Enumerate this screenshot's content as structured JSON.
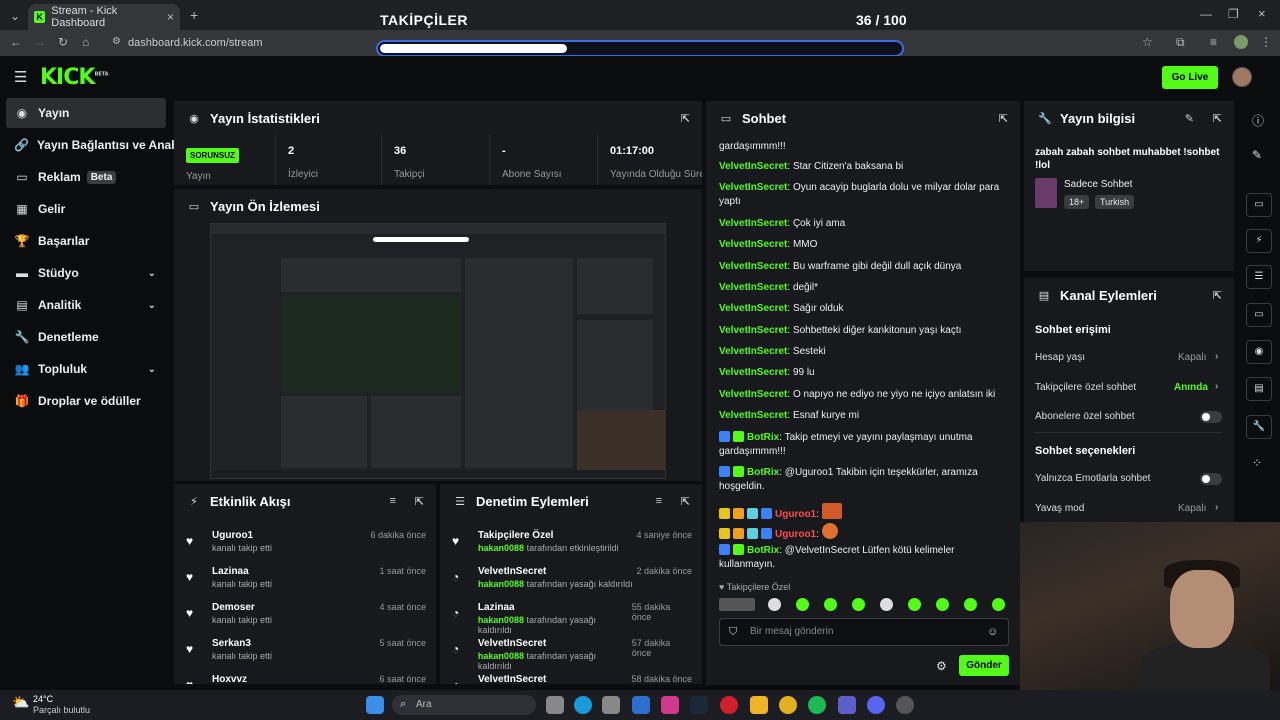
{
  "browser": {
    "tab_title": "Stream - Kick Dashboard",
    "url": "dashboard.kick.com/stream"
  },
  "overlay": {
    "title": "TAKİPÇİLER",
    "count": "36 / 100",
    "progress": 0.36
  },
  "header": {
    "logo": "KICK",
    "logo_sup": "BETA",
    "go_live": "Go Live"
  },
  "sidebar": {
    "items": [
      {
        "label": "Yayın",
        "icon": "broadcast-icon"
      },
      {
        "label": "Yayın Bağlantısı ve Anahtarı",
        "icon": "link-icon"
      },
      {
        "label": "Reklam",
        "icon": "ad-icon",
        "badge": "Beta"
      },
      {
        "label": "Gelir",
        "icon": "chart-icon"
      },
      {
        "label": "Başarılar",
        "icon": "trophy-icon"
      },
      {
        "label": "Stüdyo",
        "icon": "studio-icon"
      },
      {
        "label": "Analitik",
        "icon": "analytics-icon"
      },
      {
        "label": "Denetleme",
        "icon": "wrench-icon"
      },
      {
        "label": "Topluluk",
        "icon": "community-icon"
      },
      {
        "label": "Droplar ve ödüller",
        "icon": "gift-icon"
      }
    ]
  },
  "stats": {
    "title": "Yayın İstatistikleri",
    "status_badge": "SORUNSUZ",
    "status_label": "Yayın",
    "viewers_value": "2",
    "viewers_label": "İzleyici",
    "followers_value": "36",
    "followers_label": "Takipçi",
    "subs_value": "-",
    "subs_label": "Abone Sayısı",
    "uptime_value": "01:17:00",
    "uptime_label": "Yayında Olduğu Süre"
  },
  "preview": {
    "title": "Yayın Ön İzlemesi"
  },
  "activity": {
    "title": "Etkinlik Akışı",
    "rows": [
      {
        "name": "Uguroo1",
        "desc": "kanalı takip etti",
        "time": "6 dakika önce"
      },
      {
        "name": "Lazinaa",
        "desc": "kanalı takip etti",
        "time": "1 saat önce"
      },
      {
        "name": "Demoser",
        "desc": "kanalı takip etti",
        "time": "4 saat önce"
      },
      {
        "name": "Serkan3",
        "desc": "kanalı takip etti",
        "time": "5 saat önce"
      },
      {
        "name": "Hoxvvz",
        "desc": "",
        "time": "6 saat önce"
      }
    ]
  },
  "moderation": {
    "title": "Denetim Eylemleri",
    "rows": [
      {
        "name": "Takipçilere Özel",
        "mod": "hakan0088",
        "desc": "tarafından etkinleştirildi",
        "time": "4 saniye önce"
      },
      {
        "name": "VelvetInSecret",
        "mod": "hakan0088",
        "desc": "tarafından yasağı kaldırıldı",
        "time": "2 dakika önce"
      },
      {
        "name": "Lazinaa",
        "mod": "hakan0088",
        "desc": "tarafından yasağı kaldırıldı",
        "time": "55 dakika önce"
      },
      {
        "name": "VelvetInSecret",
        "mod": "hakan0088",
        "desc": "tarafından yasağı kaldırıldı",
        "time": "57 dakika önce"
      },
      {
        "name": "VelvetInSecret",
        "mod": "",
        "desc": "",
        "time": "58 dakika önce"
      }
    ]
  },
  "chat": {
    "title": "Sohbet",
    "top_cut": "gardaşımmm!!!",
    "messages": [
      {
        "user": "VelvetInSecret",
        "text": "Star Citizen'a baksana bi"
      },
      {
        "user": "VelvetInSecret",
        "text": "Oyun acayip buglarla dolu ve milyar dolar para yaptı"
      },
      {
        "user": "VelvetInSecret",
        "text": "Çok iyi ama"
      },
      {
        "user": "VelvetInSecret",
        "text": "MMO"
      },
      {
        "user": "VelvetInSecret",
        "text": "Bu warframe gibi değil dull açık dünya"
      },
      {
        "user": "VelvetInSecret",
        "text": "değil*"
      },
      {
        "user": "VelvetInSecret",
        "text": "Sağır olduk"
      },
      {
        "user": "VelvetInSecret",
        "text": "Sohbetteki diğer kankitonun yaşı kaçtı"
      },
      {
        "user": "VelvetInSecret",
        "text": "Sesteki"
      },
      {
        "user": "VelvetInSecret",
        "text": "99 lu"
      },
      {
        "user": "VelvetInSecret",
        "text": "O napıyo ne ediyo ne yiyo ne içiyo anlatsın iki"
      },
      {
        "user": "VelvetInSecret",
        "text": "Esnaf kurye mi"
      }
    ],
    "bot1_user": "BotRix",
    "bot1_text": "Takip etmeyi ve yayını paylaşmayı unutma gardaşımmm!!!",
    "bot2_user": "BotRix",
    "bot2_text": "@Uguroo1 Takibin için teşekkürler, aramıza hoşgeldin.",
    "red_user": "Uguroo1",
    "bot3_user": "BotRix",
    "bot3_text": "@VelvetInSecret Lütfen kötü kelimeler kullanmayın.",
    "mode_label": "Takipçilere Özel",
    "input_placeholder": "Bir mesaj gönderin",
    "send_label": "Gönder"
  },
  "stream_info": {
    "title": "Yayın bilgisi",
    "stream_title": "zabah zabah sohbet muhabbet !sohbet !lol",
    "category": "Sadece Sohbet",
    "tag1": "18+",
    "tag2": "Turkish"
  },
  "channel_actions": {
    "title": "Kanal Eylemleri",
    "section1": "Sohbet erişimi",
    "account_age_label": "Hesap yaşı",
    "account_age_value": "Kapalı",
    "followers_only_label": "Takipçilere özel sohbet",
    "followers_only_value": "Anında",
    "subs_only_label": "Abonelere özel sohbet",
    "section2": "Sohbet seçenekleri",
    "emote_only_label": "Yalnızca Emotlarla sohbet",
    "slow_mode_label": "Yavaş mod",
    "slow_mode_value": "Kapalı"
  },
  "taskbar": {
    "weather_temp": "24°C",
    "weather_desc": "Parçalı bulutlu",
    "search_placeholder": "Ara"
  },
  "colors": {
    "accent": "#53fc18",
    "panel": "#18191c",
    "bg": "#0b0c0e"
  }
}
